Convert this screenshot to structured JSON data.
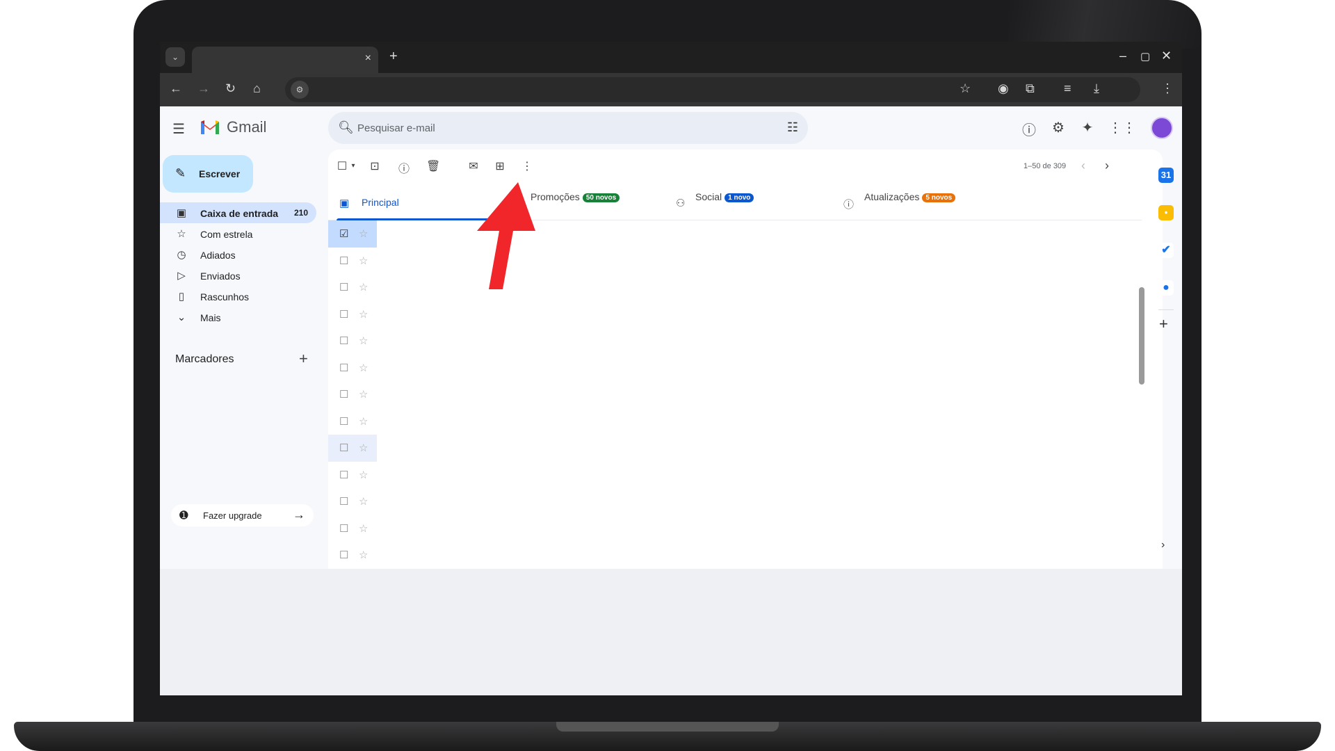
{
  "browser": {
    "tab_dropdown_icon": "chevron-down-icon",
    "tab_close": "×",
    "new_tab": "+",
    "window_controls": [
      "–",
      "▢",
      "✕"
    ]
  },
  "gmail": {
    "logo_text": "Gmail",
    "search": {
      "placeholder": "Pesquisar e-mail"
    },
    "compose_label": "Escrever",
    "nav": [
      {
        "label": "Caixa de entrada",
        "count": "210",
        "icon": "inbox-icon",
        "active": true
      },
      {
        "label": "Com estrela",
        "count": "",
        "icon": "star-icon"
      },
      {
        "label": "Adiados",
        "count": "",
        "icon": "clock-icon"
      },
      {
        "label": "Enviados",
        "count": "",
        "icon": "send-icon"
      },
      {
        "label": "Rascunhos",
        "count": "",
        "icon": "draft-icon"
      },
      {
        "label": "Mais",
        "count": "",
        "icon": "chevron-down-icon"
      }
    ],
    "labels_title": "Marcadores",
    "upgrade_label": "Fazer upgrade",
    "pagination": "1–50 de 309",
    "tabs": [
      {
        "label": "Principal",
        "badge": "",
        "active": true
      },
      {
        "label": "Promoções",
        "badge": "50 novos",
        "badge_color": "#188038"
      },
      {
        "label": "Social",
        "badge": "1 novo",
        "badge_color": "#0b57d0"
      },
      {
        "label": "Atualizações",
        "badge": "5 novos",
        "badge_color": "#e8710a"
      }
    ],
    "row_count": 13,
    "checked_rows": [
      0
    ]
  },
  "annotation": {
    "arrow_color": "#f0262b"
  }
}
